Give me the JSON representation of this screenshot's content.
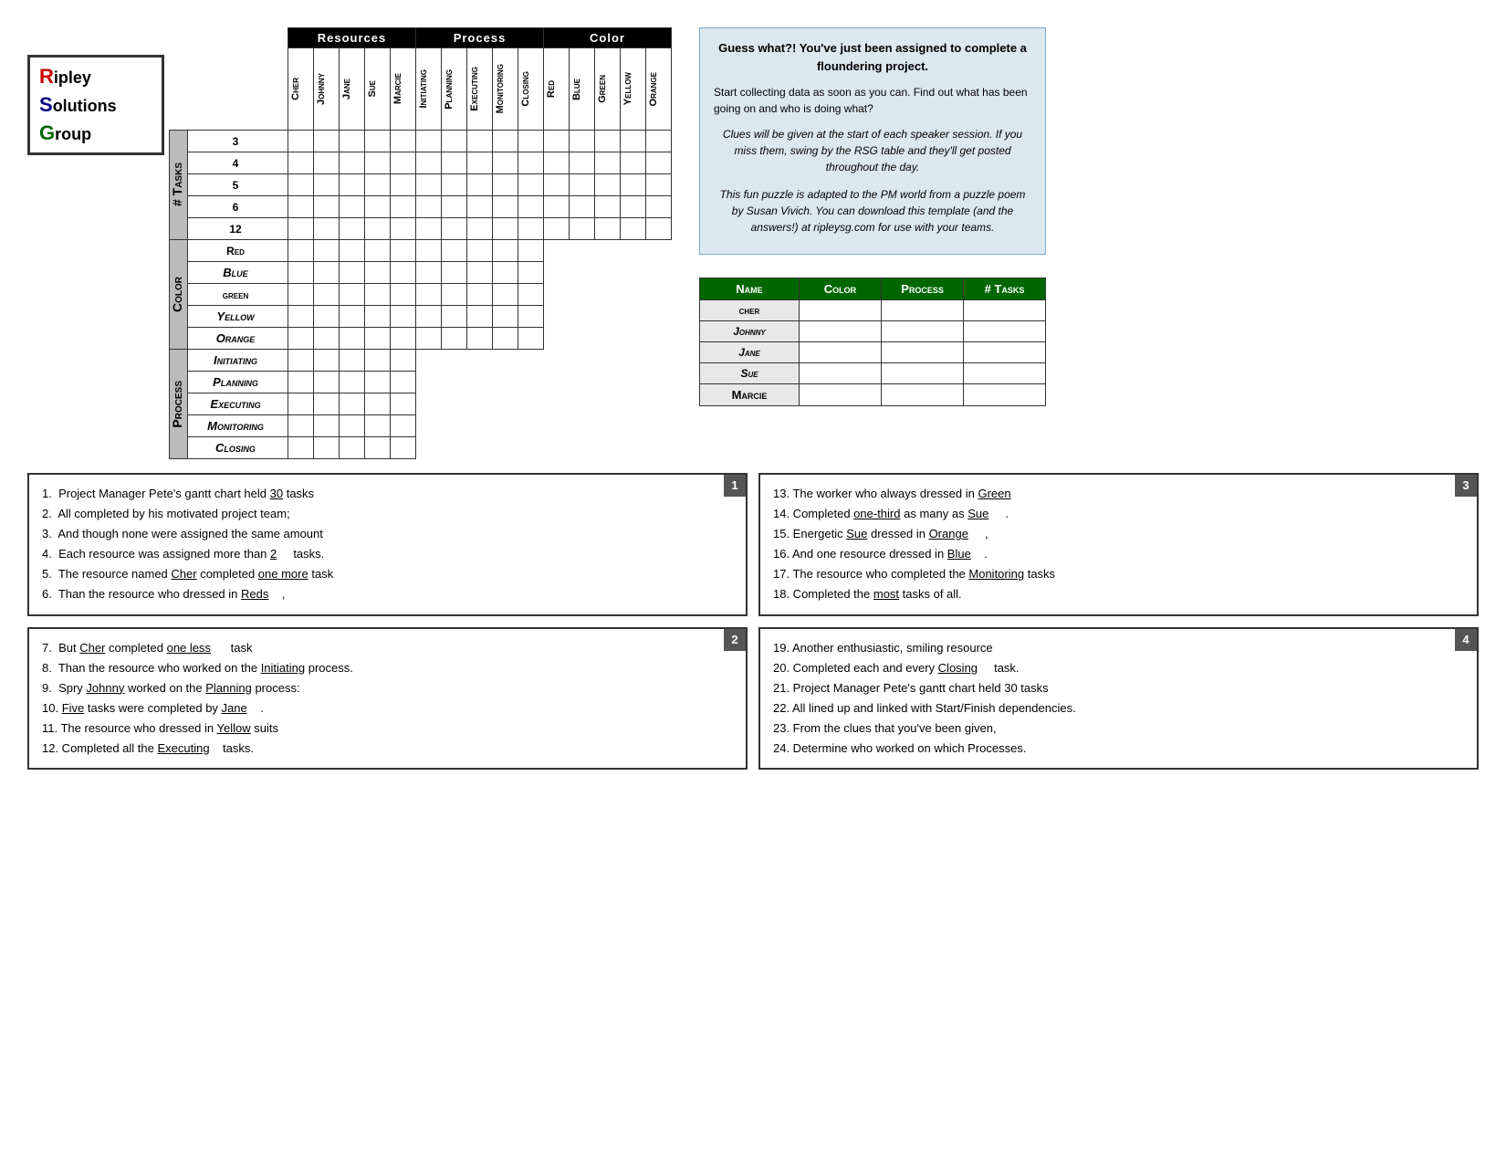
{
  "logo": {
    "line1": "ipley",
    "line2": "olutions",
    "line3": "roup",
    "r": "R",
    "s": "S",
    "g": "G"
  },
  "grid": {
    "sections": {
      "resources": "Resources",
      "process": "Process",
      "color": "Color"
    },
    "col_headers": [
      "Cher",
      "Johnny",
      "Jane",
      "Sue",
      "Marcie",
      "Initiating",
      "Planning",
      "Executing",
      "Monitoring",
      "Closing",
      "Red",
      "Blue",
      "Green",
      "Yellow",
      "Orange"
    ],
    "row_sections": {
      "tasks": "# Tasks",
      "color": "Color",
      "process": "Process"
    },
    "task_rows": [
      "3",
      "4",
      "5",
      "6",
      "12"
    ],
    "color_rows": [
      "Red",
      "Blue",
      "Green",
      "Yellow",
      "Orange"
    ],
    "process_rows": [
      "Initiating",
      "Planning",
      "Executing",
      "Monitoring",
      "Closing"
    ]
  },
  "answer_table": {
    "headers": [
      "Name",
      "Color",
      "Process",
      "# Tasks"
    ],
    "rows": [
      {
        "name": "Cher",
        "color": "",
        "process": "",
        "tasks": ""
      },
      {
        "name": "Johnny",
        "color": "",
        "process": "",
        "tasks": ""
      },
      {
        "name": "Jane",
        "color": "",
        "process": "",
        "tasks": ""
      },
      {
        "name": "Sue",
        "color": "",
        "process": "",
        "tasks": ""
      },
      {
        "name": "Marcie",
        "color": "",
        "process": "",
        "tasks": ""
      }
    ]
  },
  "info_box": {
    "title": "Guess what?! You've just been assigned to complete a floundering project.",
    "body1": "Start collecting data as soon as you can.  Find out what has been going on and who is doing what?",
    "italic1": "Clues will be given at the start of each speaker session.  If you miss them, swing by the RSG table and they'll get posted throughout the day.",
    "italic2": "This fun puzzle is adapted to the PM world from a puzzle poem by Susan Vivich.  You can download this template (and the answers!) at ripleysg.com for use with your teams."
  },
  "clue_box1": {
    "number": "1",
    "clues": [
      "1.  Project Manager Pete's gantt chart held __30__ tasks",
      "2.  All completed by his motivated project team;",
      "3.  And though none were assigned the same amount",
      "4.  Each resource was assigned more than __2____ tasks.",
      "5.  The resource named __Cher__ completed _one more_task",
      "6.  Than the resource who dressed in __Reds___ ,"
    ]
  },
  "clue_box2": {
    "number": "2",
    "clues": [
      "7.  But __Cher_ completed _one less_____ task",
      "8.  Than the resource who worked on the _Initiating_ process.",
      "9.  Spry __Johnny_ worked on the _Planning_ process:",
      "10. _Five_ tasks were completed by _Jane____.",
      "11. The resource who dressed in _Yellow_ suits",
      "12. Completed all the _Executing___ tasks."
    ]
  },
  "clue_box3": {
    "number": "3",
    "clues": [
      "13. The worker who always dressed in _Green____",
      "14. Completed _one-third_ as many as _Sue_____.",
      "15. Energetic _Sue__ dressed in _Orange____ ,",
      "16. And one resource dressed in _Blue____.",
      "17. The resource who completed the __Monitoring_ tasks",
      "18. Completed the _most_ tasks of all."
    ]
  },
  "clue_box4": {
    "number": "4",
    "clues": [
      "19. Another enthusiastic, smiling resource",
      "20. Completed each and every _Closing____ task.",
      "21. Project Manager Pete's gantt chart held 30 tasks",
      "22. All lined up and linked with Start/Finish dependencies.",
      "23. From the clues that you've been given,",
      "24. Determine who worked on which Processes."
    ]
  }
}
